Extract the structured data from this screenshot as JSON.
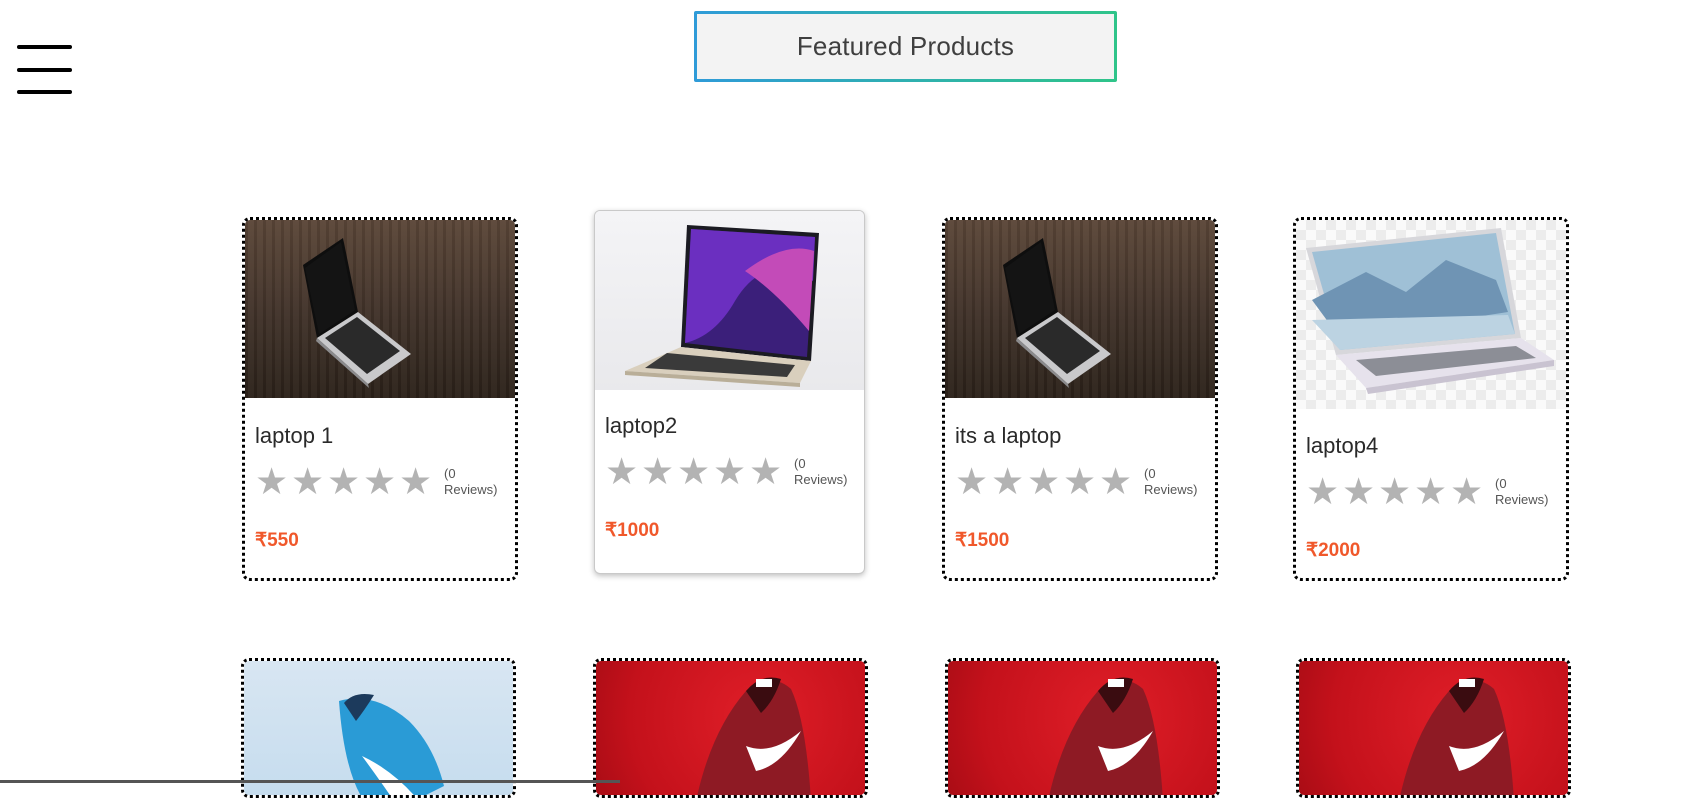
{
  "header": {
    "menu_icon": "hamburger-menu-icon",
    "title": "Featured Products"
  },
  "products": [
    {
      "name": "laptop 1",
      "reviews": "(0 Reviews)",
      "price": "₹550",
      "image": "laptop-on-wood"
    },
    {
      "name": "laptop2",
      "reviews": "(0 Reviews)",
      "price": "₹1000",
      "image": "laptop-purple-screen"
    },
    {
      "name": "its a laptop",
      "reviews": "(0 Reviews)",
      "price": "₹1500",
      "image": "laptop-on-wood"
    },
    {
      "name": "laptop4",
      "reviews": "(0 Reviews)",
      "price": "₹2000",
      "image": "laptop-mountain-wallpaper"
    }
  ],
  "second_row": [
    {
      "image": "blue-sneaker"
    },
    {
      "image": "red-sneaker"
    },
    {
      "image": "red-sneaker"
    },
    {
      "image": "red-sneaker"
    }
  ],
  "colors": {
    "price": "#f0582b",
    "star": "#b3b3b3",
    "title_border_start": "#2f9bd8",
    "title_border_end": "#2fc489"
  }
}
